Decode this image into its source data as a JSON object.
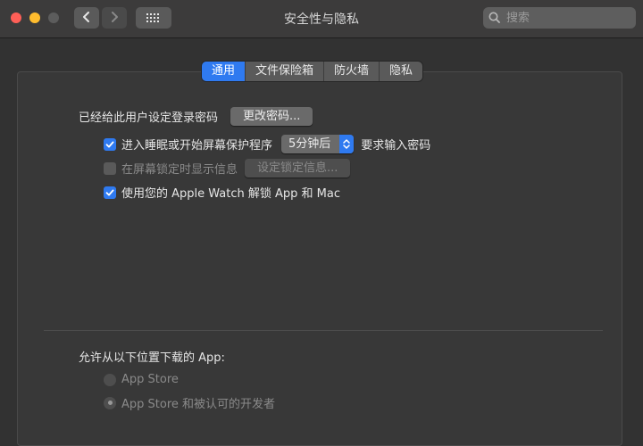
{
  "window": {
    "title": "安全性与隐私",
    "search_placeholder": "搜索"
  },
  "tabs": [
    {
      "label": "通用",
      "active": true
    },
    {
      "label": "文件保险箱",
      "active": false
    },
    {
      "label": "防火墙",
      "active": false
    },
    {
      "label": "隐私",
      "active": false
    }
  ],
  "general": {
    "password_set_label": "已经给此用户设定登录密码",
    "change_password_button": "更改密码...",
    "require_password": {
      "checked": true,
      "label_before": "进入睡眠或开始屏幕保护程序",
      "delay_value": "5分钟后",
      "label_after": "要求输入密码"
    },
    "lock_message": {
      "checked": false,
      "disabled": true,
      "label": "在屏幕锁定时显示信息",
      "button": "设定锁定信息..."
    },
    "apple_watch": {
      "checked": true,
      "label": "使用您的 Apple Watch 解锁 App 和 Mac"
    }
  },
  "downloads": {
    "heading": "允许从以下位置下载的 App:",
    "options": [
      {
        "label": "App Store",
        "selected": false
      },
      {
        "label": "App Store 和被认可的开发者",
        "selected": true
      }
    ]
  },
  "colors": {
    "accent": "#2f7af0",
    "close": "#fe5f57",
    "minimize": "#febc2e"
  }
}
